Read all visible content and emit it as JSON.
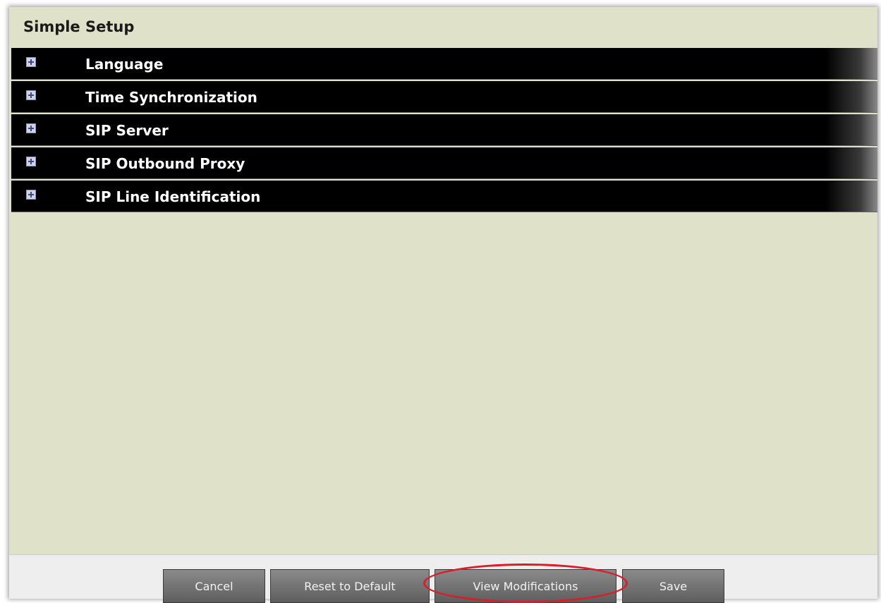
{
  "page": {
    "title": "Simple Setup"
  },
  "sections": [
    {
      "label": "Language",
      "icon": "plus-square-icon"
    },
    {
      "label": "Time Synchronization",
      "icon": "plus-square-icon"
    },
    {
      "label": "SIP Server",
      "icon": "plus-square-icon"
    },
    {
      "label": "SIP Outbound Proxy",
      "icon": "plus-square-icon"
    },
    {
      "label": "SIP Line Identification",
      "icon": "plus-square-icon"
    }
  ],
  "buttons": {
    "cancel": "Cancel",
    "reset": "Reset to Default",
    "view_modifications": "View Modifications",
    "save": "Save"
  },
  "colors": {
    "panel_bg": "#dfe1c8",
    "section_bar": "#000000",
    "highlight": "#d81e2a"
  }
}
